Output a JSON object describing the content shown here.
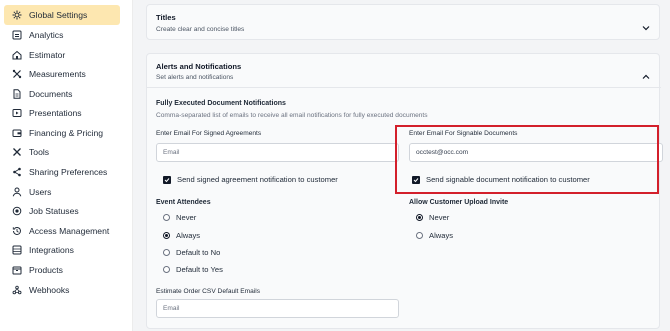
{
  "sidebar": {
    "items": [
      {
        "label": "Global Settings",
        "icon": "gear-icon",
        "active": true
      },
      {
        "label": "Analytics",
        "icon": "analytics-icon"
      },
      {
        "label": "Estimator",
        "icon": "home-icon"
      },
      {
        "label": "Measurements",
        "icon": "ruler-icon"
      },
      {
        "label": "Documents",
        "icon": "document-icon"
      },
      {
        "label": "Presentations",
        "icon": "presentation-icon"
      },
      {
        "label": "Financing & Pricing",
        "icon": "wallet-icon"
      },
      {
        "label": "Tools",
        "icon": "tools-icon"
      },
      {
        "label": "Sharing Preferences",
        "icon": "share-icon"
      },
      {
        "label": "Users",
        "icon": "users-icon"
      },
      {
        "label": "Job Statuses",
        "icon": "status-icon"
      },
      {
        "label": "Access Management",
        "icon": "history-icon"
      },
      {
        "label": "Integrations",
        "icon": "integrations-icon"
      },
      {
        "label": "Products",
        "icon": "products-icon"
      },
      {
        "label": "Webhooks",
        "icon": "webhooks-icon"
      }
    ]
  },
  "titles_card": {
    "title": "Titles",
    "subtitle": "Create clear and concise titles"
  },
  "alerts_card": {
    "title": "Alerts and Notifications",
    "subtitle": "Set alerts and notifications",
    "fully_executed": {
      "heading": "Fully Executed Document Notifications",
      "description": "Comma-separated list of emails to receive all email notifications for fully executed documents"
    },
    "signed_agreements": {
      "label": "Enter Email For Signed Agreements",
      "placeholder": "Email",
      "value": "",
      "checkbox_label": "Send signed agreement notification to customer",
      "checked": true
    },
    "signable_documents": {
      "label": "Enter Email For Signable Documents",
      "value": "occtest@occ.com",
      "checkbox_label": "Send signable document notification to customer",
      "checked": true
    },
    "event_attendees": {
      "label": "Event Attendees",
      "options": [
        "Never",
        "Always",
        "Default to No",
        "Default to Yes"
      ],
      "selected": "Always"
    },
    "upload_invite": {
      "label": "Allow Customer Upload Invite",
      "options": [
        "Never",
        "Always"
      ],
      "selected": "Never"
    },
    "csv_emails": {
      "label": "Estimate Order CSV Default Emails",
      "placeholder": "Email"
    }
  },
  "colors": {
    "active_nav": "#fde7b0",
    "highlight": "#d31f2b"
  }
}
